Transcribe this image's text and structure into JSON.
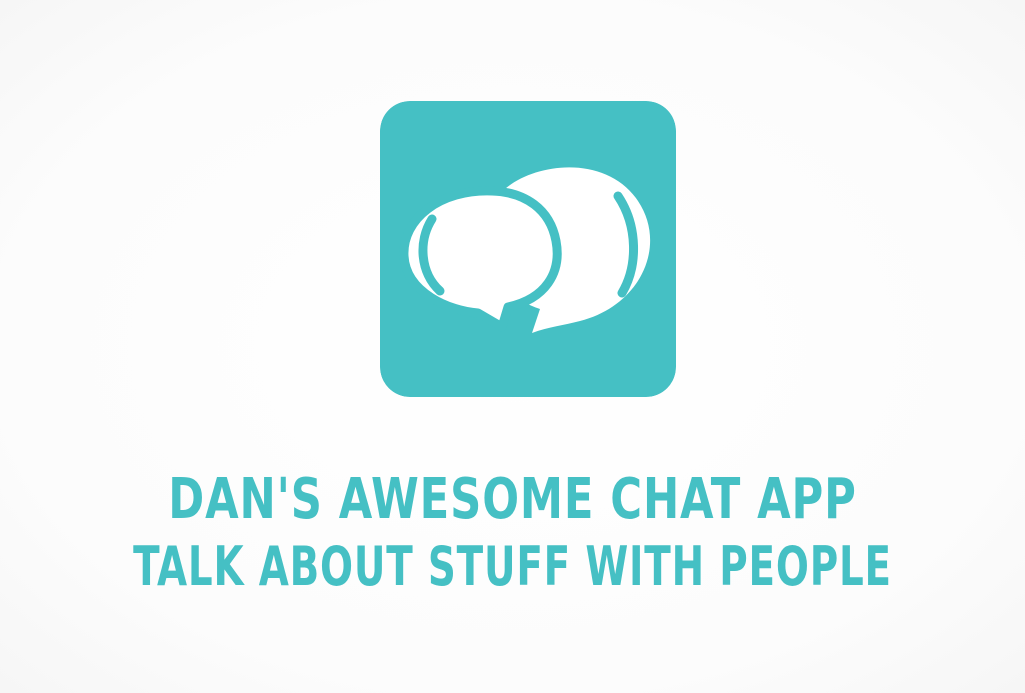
{
  "brand": {
    "accent_color": "#45c0c4",
    "background_color": "#fbfbfb",
    "icon": "chat-bubbles-icon"
  },
  "title": "DAN'S AWESOME CHAT APP",
  "tagline": "TALK ABOUT STUFF WITH PEOPLE"
}
